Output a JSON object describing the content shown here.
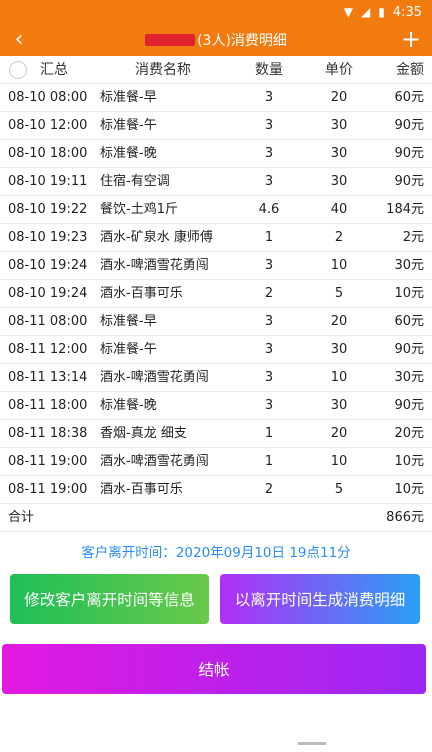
{
  "status_bar": {
    "time": "4:35",
    "icons": [
      "wifi-icon",
      "signal-icon",
      "battery-icon"
    ]
  },
  "app_bar": {
    "title_suffix": "(3人)消费明细",
    "back_icon": "chevron-left-icon",
    "add_icon": "plus-icon"
  },
  "table": {
    "headers": {
      "summary": "汇总",
      "name": "消费名称",
      "qty": "数量",
      "price": "单价",
      "amount": "金额"
    },
    "rows": [
      {
        "time": "08-10 08:00",
        "name": "标准餐-早",
        "qty": "3",
        "price": "20",
        "amount": "60元"
      },
      {
        "time": "08-10 12:00",
        "name": "标准餐-午",
        "qty": "3",
        "price": "30",
        "amount": "90元"
      },
      {
        "time": "08-10 18:00",
        "name": "标准餐-晚",
        "qty": "3",
        "price": "30",
        "amount": "90元"
      },
      {
        "time": "08-10 19:11",
        "name": "住宿-有空调",
        "qty": "3",
        "price": "30",
        "amount": "90元"
      },
      {
        "time": "08-10 19:22",
        "name": "餐饮-土鸡1斤",
        "qty": "4.6",
        "price": "40",
        "amount": "184元"
      },
      {
        "time": "08-10 19:23",
        "name": "酒水-矿泉水 康师傅",
        "qty": "1",
        "price": "2",
        "amount": "2元"
      },
      {
        "time": "08-10 19:24",
        "name": "酒水-啤酒雪花勇闯",
        "qty": "3",
        "price": "10",
        "amount": "30元"
      },
      {
        "time": "08-10 19:24",
        "name": "酒水-百事可乐",
        "qty": "2",
        "price": "5",
        "amount": "10元"
      },
      {
        "time": "08-11 08:00",
        "name": "标准餐-早",
        "qty": "3",
        "price": "20",
        "amount": "60元"
      },
      {
        "time": "08-11 12:00",
        "name": "标准餐-午",
        "qty": "3",
        "price": "30",
        "amount": "90元"
      },
      {
        "time": "08-11 13:14",
        "name": "酒水-啤酒雪花勇闯",
        "qty": "3",
        "price": "10",
        "amount": "30元"
      },
      {
        "time": "08-11 18:00",
        "name": "标准餐-晚",
        "qty": "3",
        "price": "30",
        "amount": "90元"
      },
      {
        "time": "08-11 18:38",
        "name": "香烟-真龙 细支",
        "qty": "1",
        "price": "20",
        "amount": "20元"
      },
      {
        "time": "08-11 19:00",
        "name": "酒水-啤酒雪花勇闯",
        "qty": "1",
        "price": "10",
        "amount": "10元"
      },
      {
        "time": "08-11 19:00",
        "name": "酒水-百事可乐",
        "qty": "2",
        "price": "5",
        "amount": "10元"
      }
    ],
    "total_label": "合计",
    "total_amount": "866元"
  },
  "leave_time_text": "客户离开时间：2020年09月10日 19点11分",
  "buttons": {
    "modify": "修改客户离开时间等信息",
    "generate": "以离开时间生成消费明细",
    "checkout": "结帐"
  }
}
